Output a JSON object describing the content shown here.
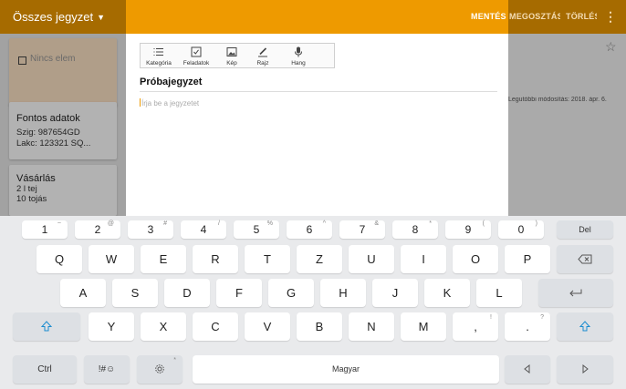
{
  "app": {
    "title": "Összes jegyzet",
    "actions": {
      "save": "MENTÉS",
      "share": "MEGOSZTÁS",
      "delete": "TÖRLÉS"
    }
  },
  "background_notes": {
    "note1_checkbox_text": "Nincs elem",
    "note2": {
      "title": "Fontos adatok",
      "lines": [
        "Szig: 987654GD",
        "Lakc: 123321 SQ..."
      ]
    },
    "note3": {
      "title": "Vásárlás",
      "lines": [
        "2 l tej",
        "10 tojás"
      ]
    },
    "last_modified": "Legutóbbi módosítás: 2018. ápr. 6."
  },
  "editor": {
    "toolbar": [
      "Kategória",
      "Feladatok",
      "Kép",
      "Rajz",
      "Hang"
    ],
    "note_title": "Próbajegyzet",
    "body_placeholder": "Írja be a jegyzetet"
  },
  "keyboard": {
    "numbers": [
      "1",
      "2",
      "3",
      "4",
      "5",
      "6",
      "7",
      "8",
      "9",
      "0"
    ],
    "number_hints": [
      "~",
      "@",
      "#",
      "/",
      "%",
      "^",
      "&",
      "*",
      "(",
      ")"
    ],
    "del": "Del",
    "row1": [
      "Q",
      "W",
      "E",
      "R",
      "T",
      "Z",
      "U",
      "I",
      "O",
      "P"
    ],
    "row2": [
      "A",
      "S",
      "D",
      "F",
      "G",
      "H",
      "J",
      "K",
      "L"
    ],
    "row3": [
      "Y",
      "X",
      "C",
      "V",
      "B",
      "N",
      "M"
    ],
    "comma": ",",
    "comma_hint": "!",
    "period": ".",
    "period_hint": "?",
    "ctrl": "Ctrl",
    "symbols": "!#☺",
    "settings_hint": "*",
    "space": "Magyar"
  },
  "colors": {
    "accent": "#ee9a00",
    "editor_bg": "#ffffff",
    "keyboard_bg": "#e9eaec"
  }
}
